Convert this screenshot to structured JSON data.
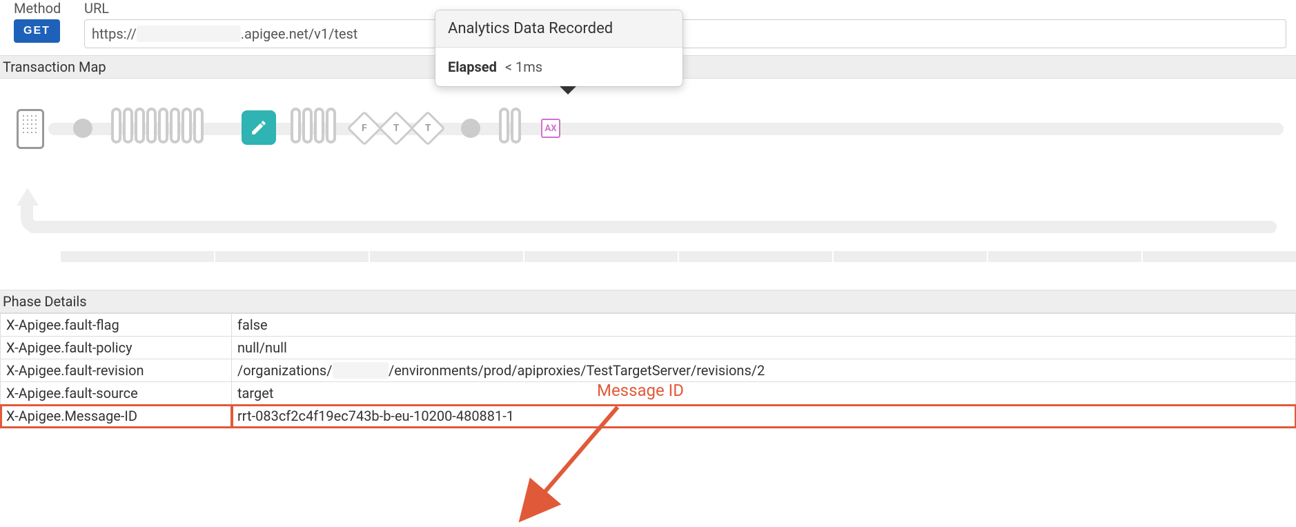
{
  "request": {
    "method_label": "Method",
    "method_value": "GET",
    "url_label": "URL",
    "url_pre": "https://",
    "url_post": ".apigee.net/v1/test"
  },
  "tx_map": {
    "header": "Transaction Map",
    "diamond1": "F",
    "diamond2": "T",
    "diamond3": "T",
    "ax": "AX"
  },
  "popover": {
    "title": "Analytics Data Recorded",
    "elapsed_label": "Elapsed",
    "elapsed_value": "< 1ms"
  },
  "phase": {
    "header": "Phase Details",
    "rows": [
      {
        "k": "X-Apigee.fault-flag",
        "v": "false"
      },
      {
        "k": "X-Apigee.fault-policy",
        "v": "null/null"
      },
      {
        "k": "X-Apigee.fault-revision",
        "v_pre": "/organizations/",
        "v_post": "/environments/prod/apiproxies/TestTargetServer/revisions/2"
      },
      {
        "k": "X-Apigee.fault-source",
        "v": "target"
      },
      {
        "k": "X-Apigee.Message-ID",
        "v": "rrt-083cf2c4f19ec743b-b-eu-10200-480881-1"
      }
    ]
  },
  "annotation": {
    "label": "Message ID"
  }
}
